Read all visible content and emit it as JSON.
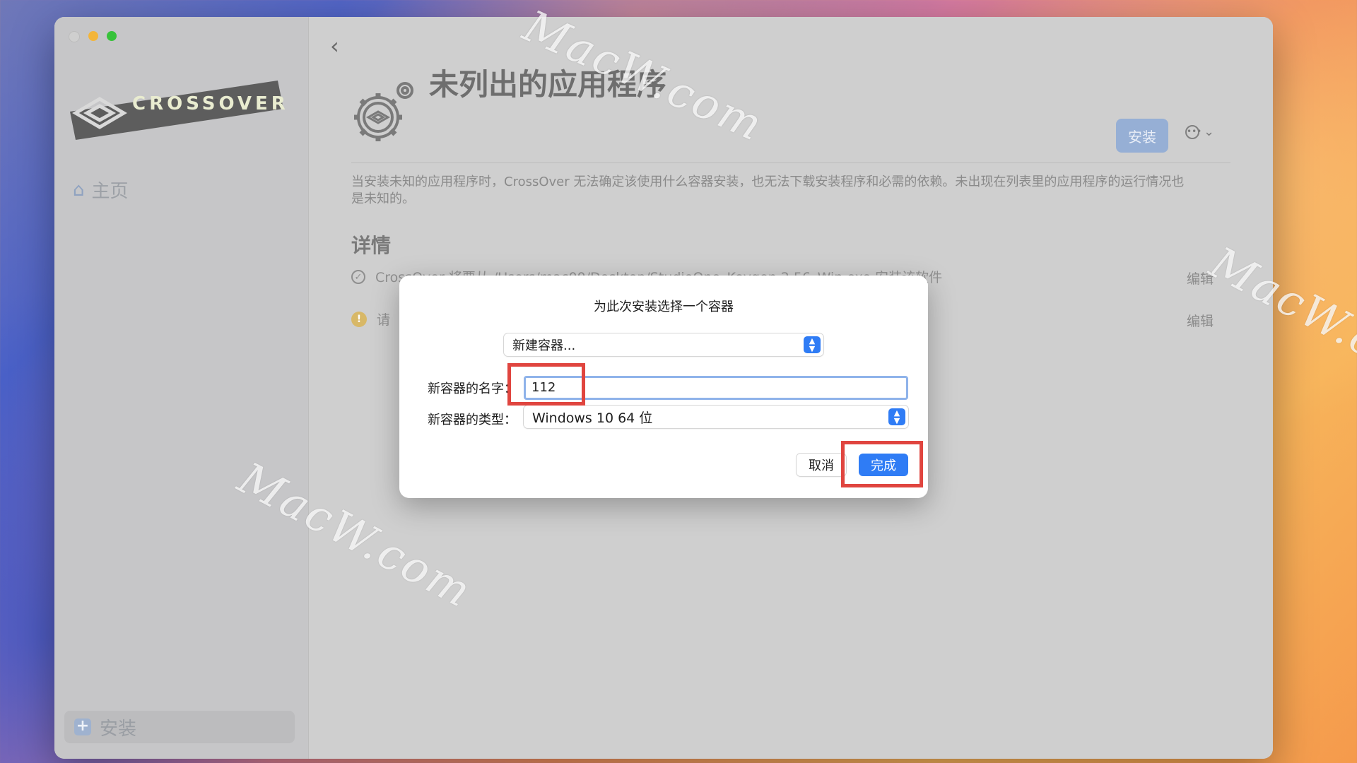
{
  "sidebar": {
    "logo_text": "CROSSOVER",
    "home_label": "主页",
    "install_label": "安装"
  },
  "main": {
    "title": "未列出的应用程序",
    "install_button": "安装",
    "description": "当安装未知的应用程序时，CrossOver 无法确定该使用什么容器安装，也无法下载安装程序和必需的依赖。未出现在列表里的应用程序的运行情况也是未知的。",
    "details_title": "详情",
    "details": [
      {
        "text": "CrossOver 将要从 /Users/mac00/Desktop/StudioOne_Keygen 2.56_Win.exe 安装该软件",
        "edit": "编辑"
      },
      {
        "text": "请",
        "edit": "编辑"
      }
    ]
  },
  "dialog": {
    "title": "为此次安装选择一个容器",
    "container_select": "新建容器...",
    "name_label": "新容器的名字：",
    "name_value": "112",
    "type_label": "新容器的类型：",
    "type_value": "Windows 10 64 位",
    "cancel": "取消",
    "done": "完成"
  },
  "watermark": "MacW.com",
  "colors": {
    "accent": "#2f7cf5",
    "highlight": "#e0453f"
  }
}
